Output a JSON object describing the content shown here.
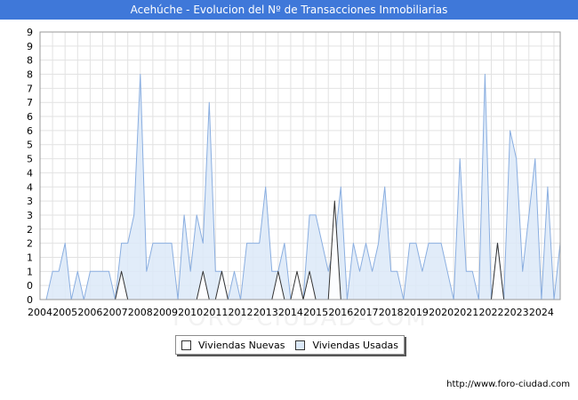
{
  "source": "http://www.foro-ciudad.com",
  "chart_data": {
    "type": "area",
    "title": "Acehúche - Evolucion del Nº de Transacciones Inmobiliarias",
    "xlabel": "",
    "ylabel": "",
    "xlim": [
      2004,
      2024.75
    ],
    "ylim": [
      0,
      9.5
    ],
    "x_ticks": [
      2004,
      2005,
      2006,
      2007,
      2008,
      2009,
      2010,
      2011,
      2012,
      2013,
      2014,
      2015,
      2016,
      2017,
      2018,
      2019,
      2020,
      2021,
      2022,
      2023,
      2024
    ],
    "y_ticks": [
      0,
      1,
      2,
      3,
      4,
      5,
      6,
      7,
      8,
      9
    ],
    "grid": true,
    "legend_position": "bottom-center",
    "series": [
      {
        "name": "Viviendas Nuevas",
        "color": "#ffffff",
        "stroke": "#333333",
        "points": [
          [
            2004.25,
            0
          ],
          [
            2007.0,
            0
          ],
          [
            2007.25,
            1
          ],
          [
            2007.5,
            0
          ],
          [
            2010.25,
            0
          ],
          [
            2010.5,
            1
          ],
          [
            2010.75,
            0
          ],
          [
            2011.0,
            0
          ],
          [
            2011.25,
            1
          ],
          [
            2011.5,
            0
          ],
          [
            2013.25,
            0
          ],
          [
            2013.5,
            1
          ],
          [
            2013.75,
            0
          ],
          [
            2014.0,
            0
          ],
          [
            2014.25,
            1
          ],
          [
            2014.5,
            0
          ],
          [
            2014.75,
            1
          ],
          [
            2015.0,
            0
          ],
          [
            2015.5,
            0
          ],
          [
            2015.75,
            3.5
          ],
          [
            2016.0,
            0
          ],
          [
            2022.0,
            0
          ],
          [
            2022.25,
            2
          ],
          [
            2022.5,
            0
          ],
          [
            2024.75,
            0
          ]
        ]
      },
      {
        "name": "Viviendas Usadas",
        "color": "#dce9f8",
        "stroke": "#8aaee0",
        "points": [
          [
            2004.25,
            0
          ],
          [
            2004.5,
            1
          ],
          [
            2004.75,
            1
          ],
          [
            2005.0,
            2
          ],
          [
            2005.25,
            0
          ],
          [
            2005.5,
            1
          ],
          [
            2005.75,
            0
          ],
          [
            2006.0,
            1
          ],
          [
            2006.25,
            1
          ],
          [
            2006.5,
            1
          ],
          [
            2006.75,
            1
          ],
          [
            2007.0,
            0
          ],
          [
            2007.25,
            2
          ],
          [
            2007.5,
            2
          ],
          [
            2007.75,
            3
          ],
          [
            2008.0,
            8
          ],
          [
            2008.25,
            1
          ],
          [
            2008.5,
            2
          ],
          [
            2008.75,
            2
          ],
          [
            2009.0,
            2
          ],
          [
            2009.25,
            2
          ],
          [
            2009.5,
            0
          ],
          [
            2009.75,
            3
          ],
          [
            2010.0,
            1
          ],
          [
            2010.25,
            3
          ],
          [
            2010.5,
            2
          ],
          [
            2010.75,
            7
          ],
          [
            2011.0,
            1
          ],
          [
            2011.25,
            1
          ],
          [
            2011.5,
            0
          ],
          [
            2011.75,
            1
          ],
          [
            2012.0,
            0
          ],
          [
            2012.25,
            2
          ],
          [
            2012.5,
            2
          ],
          [
            2012.75,
            2
          ],
          [
            2013.0,
            4
          ],
          [
            2013.25,
            1
          ],
          [
            2013.5,
            1
          ],
          [
            2013.75,
            2
          ],
          [
            2014.0,
            0
          ],
          [
            2014.25,
            0
          ],
          [
            2014.5,
            0
          ],
          [
            2014.75,
            3
          ],
          [
            2015.0,
            3
          ],
          [
            2015.25,
            2
          ],
          [
            2015.5,
            1
          ],
          [
            2015.75,
            2
          ],
          [
            2016.0,
            4
          ],
          [
            2016.25,
            0
          ],
          [
            2016.5,
            2
          ],
          [
            2016.75,
            1
          ],
          [
            2017.0,
            2
          ],
          [
            2017.25,
            1
          ],
          [
            2017.5,
            2
          ],
          [
            2017.75,
            4
          ],
          [
            2018.0,
            1
          ],
          [
            2018.25,
            1
          ],
          [
            2018.5,
            0
          ],
          [
            2018.75,
            2
          ],
          [
            2019.0,
            2
          ],
          [
            2019.25,
            1
          ],
          [
            2019.5,
            2
          ],
          [
            2019.75,
            2
          ],
          [
            2020.0,
            2
          ],
          [
            2020.25,
            1
          ],
          [
            2020.5,
            0
          ],
          [
            2020.75,
            5
          ],
          [
            2021.0,
            1
          ],
          [
            2021.25,
            1
          ],
          [
            2021.5,
            0
          ],
          [
            2021.75,
            8
          ],
          [
            2022.0,
            0
          ],
          [
            2022.25,
            2
          ],
          [
            2022.5,
            0
          ],
          [
            2022.75,
            6
          ],
          [
            2023.0,
            5
          ],
          [
            2023.25,
            1
          ],
          [
            2023.5,
            3
          ],
          [
            2023.75,
            5
          ],
          [
            2024.0,
            0
          ],
          [
            2024.25,
            4
          ],
          [
            2024.5,
            0
          ],
          [
            2024.75,
            2
          ]
        ]
      }
    ]
  }
}
